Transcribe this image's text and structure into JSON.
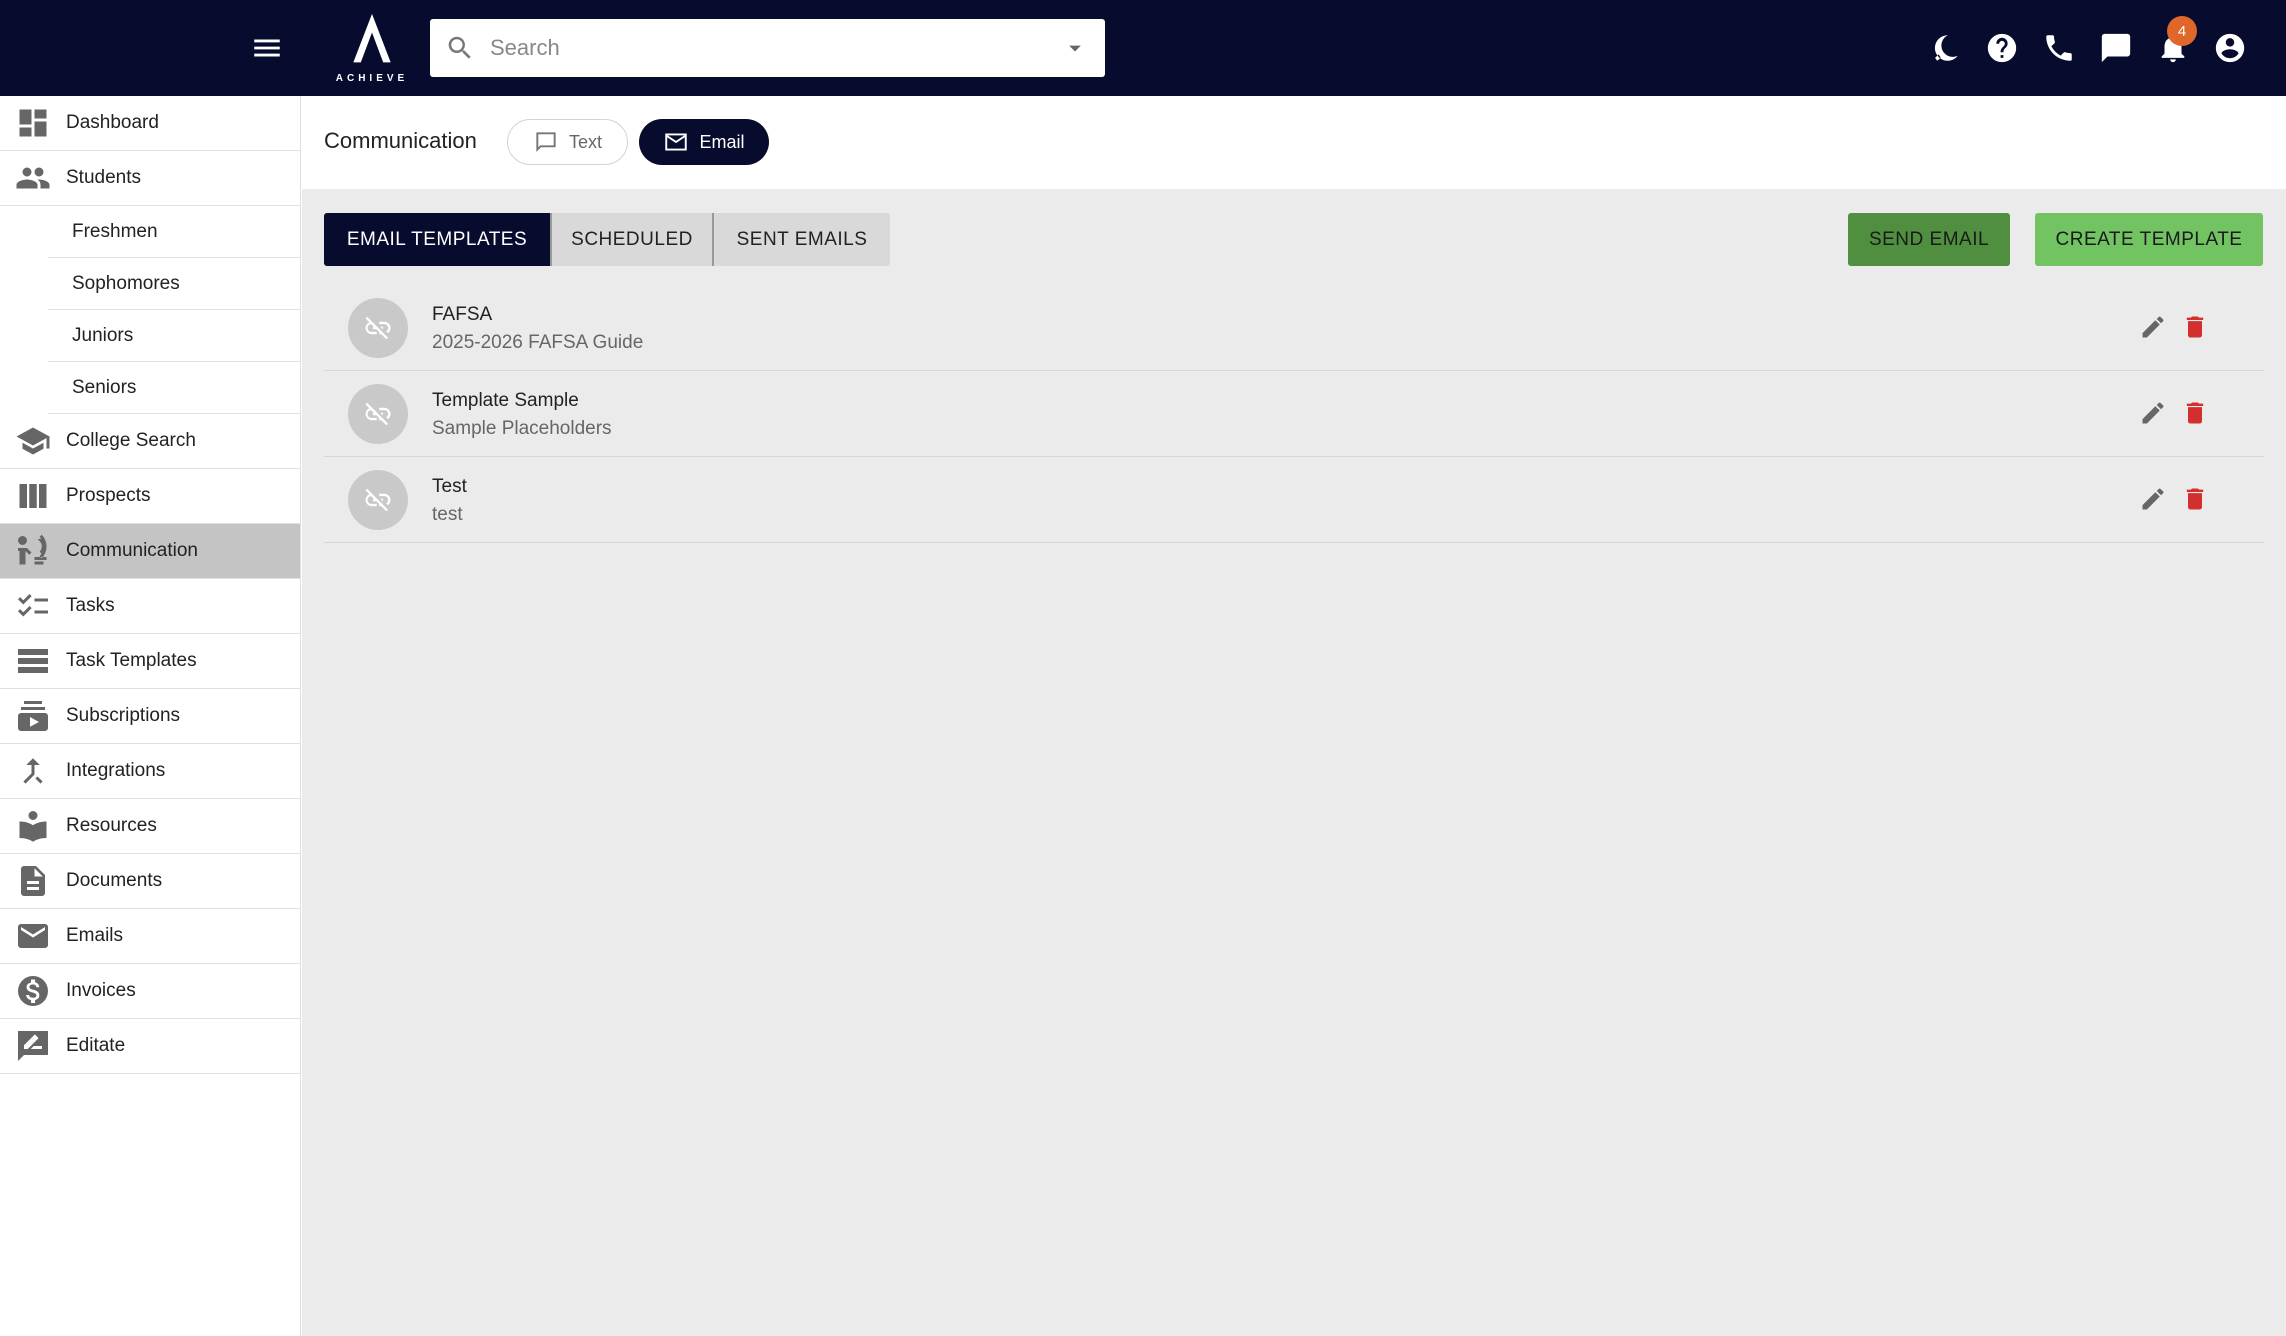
{
  "app": {
    "logo_text": "ACHIEVE",
    "search_placeholder": "Search",
    "notification_count": "4"
  },
  "top_icons": [
    "theme-toggle-icon",
    "help-icon",
    "phone-icon",
    "chat-icon",
    "bell-icon",
    "account-icon"
  ],
  "sidebar": {
    "items": [
      {
        "label": "Dashboard",
        "icon": "dashboard-icon"
      },
      {
        "label": "Students",
        "icon": "people-icon"
      },
      {
        "label": "College Search",
        "icon": "school-icon"
      },
      {
        "label": "Prospects",
        "icon": "columns-icon"
      },
      {
        "label": "Communication",
        "icon": "communication-icon",
        "active": true
      },
      {
        "label": "Tasks",
        "icon": "checklist-icon"
      },
      {
        "label": "Task Templates",
        "icon": "list-icon"
      },
      {
        "label": "Subscriptions",
        "icon": "subscriptions-icon"
      },
      {
        "label": "Integrations",
        "icon": "merge-icon"
      },
      {
        "label": "Resources",
        "icon": "book-icon"
      },
      {
        "label": "Documents",
        "icon": "document-icon"
      },
      {
        "label": "Emails",
        "icon": "email-icon"
      },
      {
        "label": "Invoices",
        "icon": "dollar-icon"
      },
      {
        "label": "Editate",
        "icon": "edit-note-icon"
      }
    ],
    "student_subitems": [
      "Freshmen",
      "Sophomores",
      "Juniors",
      "Seniors"
    ]
  },
  "header": {
    "title": "Communication",
    "text_pill": "Text",
    "email_pill": "Email"
  },
  "tabs": [
    "EMAIL TEMPLATES",
    "SCHEDULED",
    "SENT EMAILS"
  ],
  "actions": {
    "send_email": "SEND EMAIL",
    "create_template": "CREATE TEMPLATE"
  },
  "templates": [
    {
      "name": "FAFSA",
      "subject": "2025-2026 FAFSA Guide"
    },
    {
      "name": "Template Sample",
      "subject": "Sample Placeholders"
    },
    {
      "name": "Test",
      "subject": "test"
    }
  ],
  "colors": {
    "navy": "#070b2e",
    "send_green": "#4f8f3f",
    "create_green": "#72c463",
    "delete_red": "#d32f2f",
    "badge_orange": "#e0662a"
  }
}
